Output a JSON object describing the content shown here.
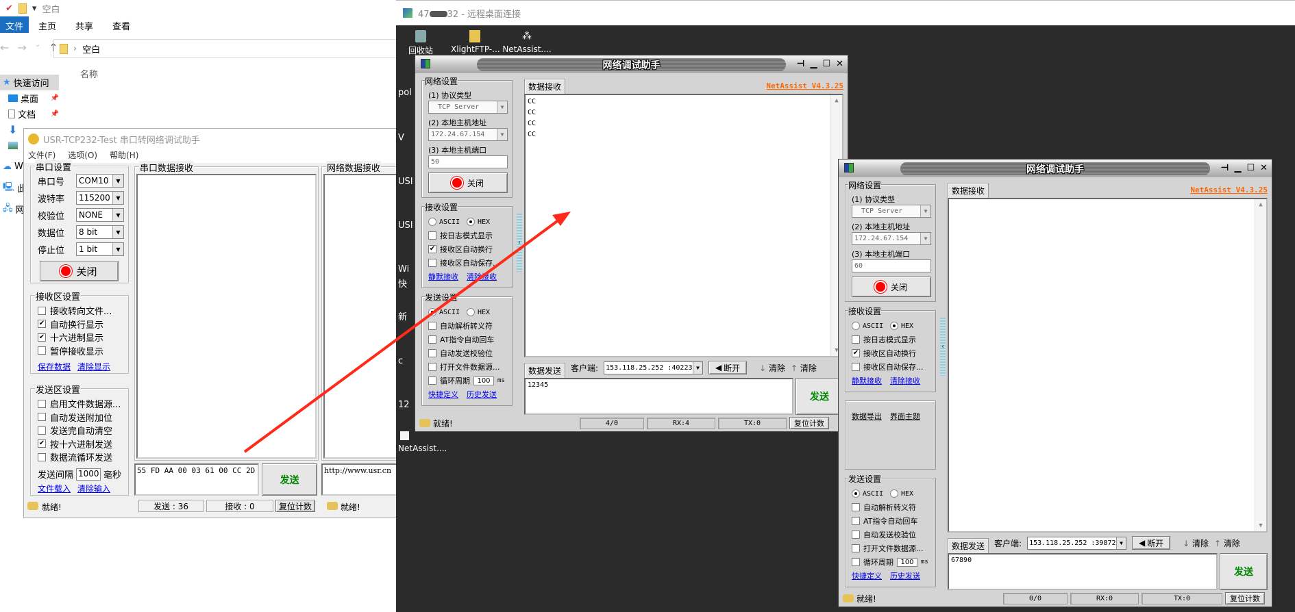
{
  "explorer": {
    "quick_title": "空白",
    "ribbon_tabs": [
      "文件",
      "主页",
      "共享",
      "查看"
    ],
    "address": "空白",
    "column_name": "名称",
    "sidebar": [
      "快速访问",
      "桌面",
      "文档",
      "",
      "",
      "W",
      "此",
      "网"
    ]
  },
  "usr": {
    "title": "USR-TCP232-Test 串口转网络调试助手",
    "menu": [
      "文件(F)",
      "选项(O)",
      "帮助(H)"
    ],
    "serial_group": "串口设置",
    "fields": [
      {
        "label": "串口号",
        "value": "COM10"
      },
      {
        "label": "波特率",
        "value": "115200"
      },
      {
        "label": "校验位",
        "value": "NONE"
      },
      {
        "label": "数据位",
        "value": "8 bit"
      },
      {
        "label": "停止位",
        "value": "1 bit"
      }
    ],
    "close_label": "关闭",
    "recv_group": "接收区设置",
    "recv_checks": [
      {
        "label": "接收转向文件...",
        "checked": false
      },
      {
        "label": "自动换行显示",
        "checked": true
      },
      {
        "label": "十六进制显示",
        "checked": true
      },
      {
        "label": "暂停接收显示",
        "checked": false
      }
    ],
    "recv_links": [
      "保存数据",
      "清除显示"
    ],
    "send_group": "发送区设置",
    "send_checks": [
      {
        "label": "启用文件数据源...",
        "checked": false
      },
      {
        "label": "自动发送附加位",
        "checked": false
      },
      {
        "label": "发送完自动清空",
        "checked": false
      },
      {
        "label": "按十六进制发送",
        "checked": true
      },
      {
        "label": "数据流循环发送",
        "checked": false
      }
    ],
    "interval_label": "发送间隔",
    "interval_value": "1000",
    "interval_unit": "毫秒",
    "send_links": [
      "文件载入",
      "清除输入"
    ],
    "serial_recv_title": "串口数据接收",
    "net_recv_title": "网络数据接收",
    "serial_send_text": "55 FD AA 00 03 61 00 CC 2D",
    "send_button": "发送",
    "net_send_text": "http://www.usr.cn",
    "status": "就绪!",
    "sent_count": "发送 : 36",
    "recv_count": "接收 : 0",
    "reset_label": "复位计数",
    "net_status": "就绪!"
  },
  "rdp": {
    "title_prefix": "47",
    "title_suffix": "32 - 远程桌面连接",
    "desktop_icons": [
      "回收站",
      "XlightFTP-...",
      "NetAssist...."
    ],
    "edge_labels": [
      "pol",
      "V",
      "USI",
      "USI",
      "Wi",
      "快",
      "新",
      "c",
      "12"
    ],
    "bottom_icon_label": "NetAssist...."
  },
  "netassist": [
    {
      "title": "网络调试助手",
      "net_group": "网络设置",
      "protocol_label": "(1) 协议类型",
      "protocol": "TCP Server",
      "host_label": "(2) 本地主机地址",
      "host": "172.24.67.154",
      "port_label": "(3) 本地主机端口",
      "port": "50",
      "close_label": "关闭",
      "recv_group": "接收设置",
      "ascii": "ASCII",
      "hex": "HEX",
      "recv_mode": "HEX",
      "recv_checks": [
        {
          "label": "按日志模式显示",
          "checked": false
        },
        {
          "label": "接收区自动换行",
          "checked": true
        },
        {
          "label": "接收区自动保存...",
          "checked": false
        }
      ],
      "recv_links": [
        "静默接收",
        "清除接收"
      ],
      "extra_links": [],
      "send_group": "发送设置",
      "send_mode": "ASCII",
      "send_checks": [
        {
          "label": "自动解析转义符",
          "checked": false
        },
        {
          "label": "AT指令自动回车",
          "checked": false
        },
        {
          "label": "自动发送校验位",
          "checked": false
        },
        {
          "label": "打开文件数据源...",
          "checked": false
        }
      ],
      "cycle_label": "循环周期",
      "cycle_value": "100",
      "cycle_unit": "ms",
      "send_links": [
        "快捷定义",
        "历史发送"
      ],
      "recv_tab": "数据接收",
      "version": "NetAssist V4.3.25",
      "received_lines": [
        "CC",
        "CC",
        "CC",
        "CC"
      ],
      "send_tab": "数据发送",
      "client_label": "客户端:",
      "client": "153.118.25.252 :40223",
      "disconnect": "断开",
      "clear1": "清除",
      "clear2": "清除",
      "send_text": "12345",
      "send_button": "发送",
      "status": "就绪!",
      "counts": "4/0",
      "rx": "RX:4",
      "tx": "TX:0",
      "reset": "复位计数"
    },
    {
      "title": "网络调试助手",
      "net_group": "网络设置",
      "protocol_label": "(1) 协议类型",
      "protocol": "TCP Server",
      "host_label": "(2) 本地主机地址",
      "host": "172.24.67.154",
      "port_label": "(3) 本地主机端口",
      "port": "60",
      "close_label": "关闭",
      "recv_group": "接收设置",
      "ascii": "ASCII",
      "hex": "HEX",
      "recv_mode": "HEX",
      "recv_checks": [
        {
          "label": "按日志模式显示",
          "checked": false
        },
        {
          "label": "接收区自动换行",
          "checked": true
        },
        {
          "label": "接收区自动保存...",
          "checked": false
        }
      ],
      "recv_links": [
        "静默接收",
        "清除接收"
      ],
      "extra_links": [
        "数据导出",
        "界面主题"
      ],
      "send_group": "发送设置",
      "send_mode": "ASCII",
      "send_checks": [
        {
          "label": "自动解析转义符",
          "checked": false
        },
        {
          "label": "AT指令自动回车",
          "checked": false
        },
        {
          "label": "自动发送校验位",
          "checked": false
        },
        {
          "label": "打开文件数据源...",
          "checked": false
        }
      ],
      "cycle_label": "循环周期",
      "cycle_value": "100",
      "cycle_unit": "ms",
      "send_links": [
        "快捷定义",
        "历史发送"
      ],
      "recv_tab": "数据接收",
      "version": "NetAssist V4.3.25",
      "received_lines": [],
      "send_tab": "数据发送",
      "client_label": "客户端:",
      "client": "153.118.25.252 :39872",
      "disconnect": "断开",
      "clear1": "清除",
      "clear2": "清除",
      "send_text": "67890",
      "send_button": "发送",
      "status": "就绪!",
      "counts": "0/0",
      "rx": "RX:0",
      "tx": "TX:0",
      "reset": "复位计数"
    }
  ],
  "colors": {
    "accent_blue": "#1a6fc0",
    "version_orange": "#ff6600",
    "send_green": "#008800",
    "arrow_red": "#ff2a1a",
    "led_red": "#ff0000"
  }
}
